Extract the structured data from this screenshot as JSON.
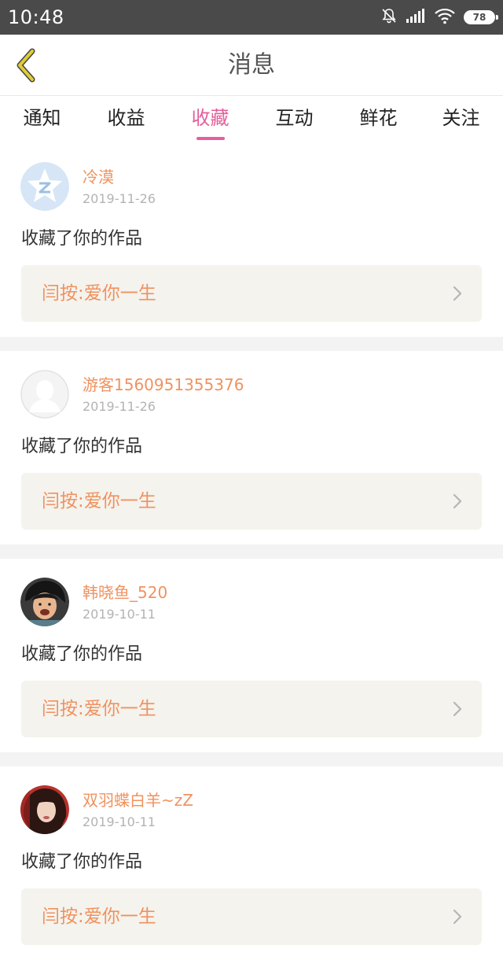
{
  "status_bar": {
    "time": "10:48",
    "battery": "78",
    "icons": [
      "bell-muted-icon",
      "signal-icon",
      "wifi-icon",
      "battery-icon"
    ]
  },
  "header": {
    "title": "消息",
    "back_icon": "back-chevron-icon"
  },
  "tabs": [
    {
      "label": "通知",
      "active": false
    },
    {
      "label": "收益",
      "active": false
    },
    {
      "label": "收藏",
      "active": true
    },
    {
      "label": "互动",
      "active": false
    },
    {
      "label": "鲜花",
      "active": false
    },
    {
      "label": "关注",
      "active": false
    }
  ],
  "colors": {
    "accent": "#e45f9c",
    "username": "#f0925f",
    "date": "#b3b3b3",
    "work_box_bg": "#f4f3ee",
    "status_bar_bg": "#4a4a4a",
    "back_icon": "#d8c230"
  },
  "feed": [
    {
      "user": "冷漠",
      "date": "2019-11-26",
      "action": "收藏了你的作品",
      "work": "闫按:爱你一生",
      "avatar": "qq-star-avatar"
    },
    {
      "user": "游客1560951355376",
      "date": "2019-11-26",
      "action": "收藏了你的作品",
      "work": "闫按:爱你一生",
      "avatar": "default-silhouette-avatar"
    },
    {
      "user": "韩晓鱼_520",
      "date": "2019-10-11",
      "action": "收藏了你的作品",
      "work": "闫按:爱你一生",
      "avatar": "photo-avatar"
    },
    {
      "user": "双羽蝶白羊~zZ",
      "date": "2019-10-11",
      "action": "收藏了你的作品",
      "work": "闫按:爱你一生",
      "avatar": "photo-avatar"
    }
  ]
}
